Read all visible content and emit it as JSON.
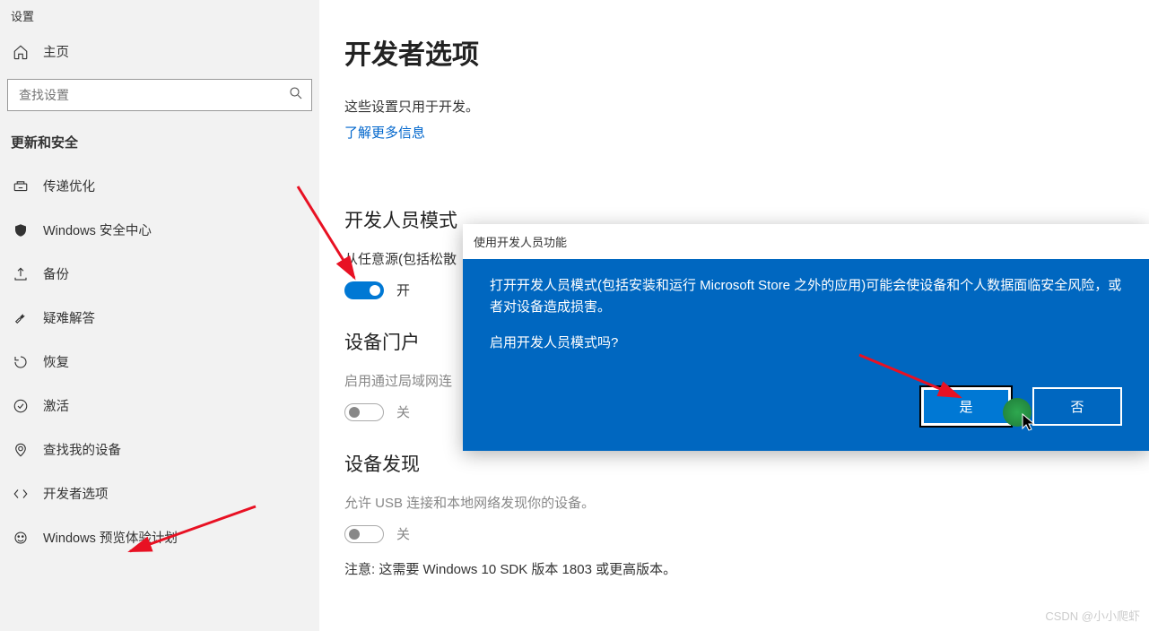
{
  "app_title": "设置",
  "home_label": "主页",
  "search_placeholder": "查找设置",
  "section_header": "更新和安全",
  "sidebar_items": [
    {
      "label": "传递优化",
      "icon": "delivery"
    },
    {
      "label": "Windows 安全中心",
      "icon": "shield"
    },
    {
      "label": "备份",
      "icon": "backup"
    },
    {
      "label": "疑难解答",
      "icon": "troubleshoot"
    },
    {
      "label": "恢复",
      "icon": "recovery"
    },
    {
      "label": "激活",
      "icon": "activation"
    },
    {
      "label": "查找我的设备",
      "icon": "find"
    },
    {
      "label": "开发者选项",
      "icon": "developer"
    },
    {
      "label": "Windows 预览体验计划",
      "icon": "insider"
    }
  ],
  "main_title": "开发者选项",
  "main_desc": "这些设置只用于开发。",
  "learn_more": "了解更多信息",
  "sections": {
    "dev_mode": {
      "title": "开发人员模式",
      "desc": "从任意源(包括松散",
      "toggle_state": "开"
    },
    "device_portal": {
      "title": "设备门户",
      "desc": "启用通过局域网连",
      "toggle_state": "关"
    },
    "device_discovery": {
      "title": "设备发现",
      "desc": "允许 USB 连接和本地网络发现你的设备。",
      "toggle_state": "关",
      "note": "注意: 这需要 Windows 10 SDK 版本 1803 或更高版本。"
    }
  },
  "dialog": {
    "title": "使用开发人员功能",
    "body": "打开开发人员模式(包括安装和运行 Microsoft Store 之外的应用)可能会使设备和个人数据面临安全风险，或者对设备造成损害。",
    "question": "启用开发人员模式吗?",
    "yes": "是",
    "no": "否"
  },
  "watermark": "CSDN @小小爬虾"
}
